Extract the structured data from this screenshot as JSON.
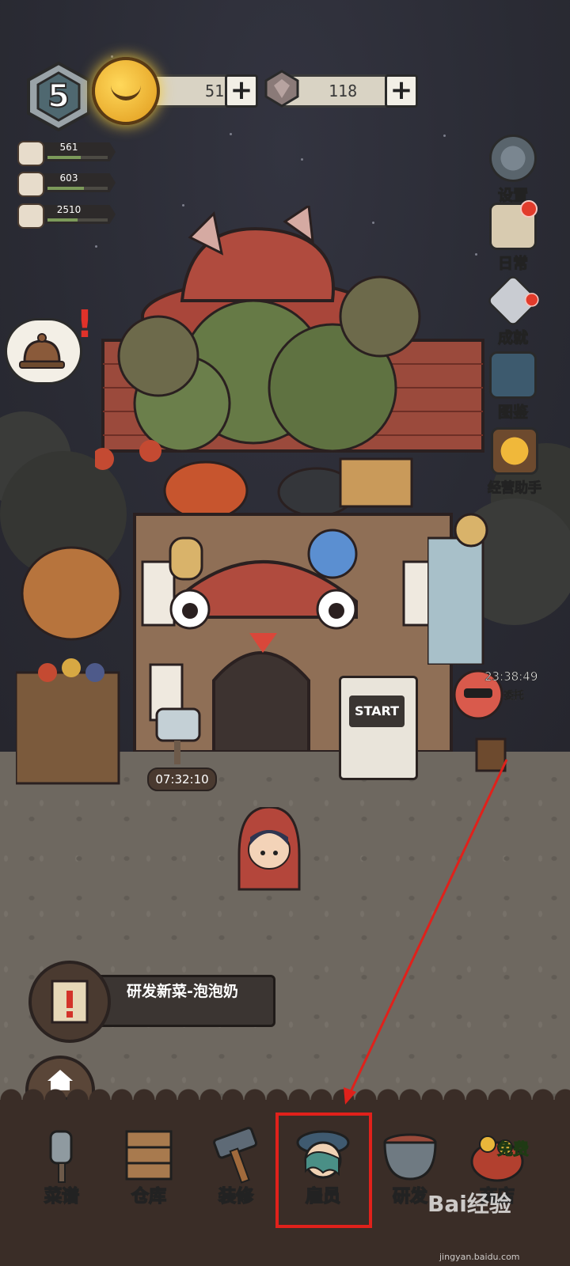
{
  "hud": {
    "level": "5",
    "coins": "5153",
    "gems": "118",
    "plus": "+"
  },
  "stats": [
    {
      "icon": "jam-jar-icon",
      "value": "561",
      "fill": 0.55
    },
    {
      "icon": "vegetables-icon",
      "value": "603",
      "fill": 0.6
    },
    {
      "icon": "broom-icon",
      "value": "2510",
      "fill": 0.5
    }
  ],
  "side_menu": [
    {
      "id": "settings",
      "icon": "gear-icon",
      "label": "设置",
      "badge": false
    },
    {
      "id": "daily",
      "icon": "scroll-quill-icon",
      "label": "日常",
      "badge": true
    },
    {
      "id": "achievements",
      "icon": "diamond-icon",
      "label": "成就",
      "badge": true
    },
    {
      "id": "codex",
      "icon": "book-icon",
      "label": "图鉴",
      "badge": false
    },
    {
      "id": "assistant",
      "icon": "coin-jar-icon",
      "label": "经营助手",
      "badge": false
    }
  ],
  "scene": {
    "mailbox_timer": "07:32:10",
    "arcade_label": "START",
    "commission_timer": "23:38:49",
    "commission_label": "委托"
  },
  "quest": {
    "text": "研发新菜-泡泡奶"
  },
  "home": {
    "label": "首页"
  },
  "nav": [
    {
      "id": "recipes",
      "icon": "spatula-icon",
      "label": "菜谱"
    },
    {
      "id": "warehouse",
      "icon": "shelf-icon",
      "label": "仓库"
    },
    {
      "id": "decorate",
      "icon": "hammer-icon",
      "label": "装修"
    },
    {
      "id": "hire",
      "icon": "employee-icon",
      "label": "雇员"
    },
    {
      "id": "research",
      "icon": "pot-icon",
      "label": "研发"
    },
    {
      "id": "shop",
      "icon": "treasure-bag-icon",
      "label": "商店"
    }
  ],
  "shop_badge": "免费",
  "colors": {
    "sky": "#2a2b34",
    "ground": "#6e6860",
    "bottom_bar": "#3a2d27",
    "highlight": "#e0211b",
    "badge_red": "#e23b2b"
  },
  "watermark": {
    "brand": "Bai经验",
    "url": "jingyan.baidu.com"
  }
}
